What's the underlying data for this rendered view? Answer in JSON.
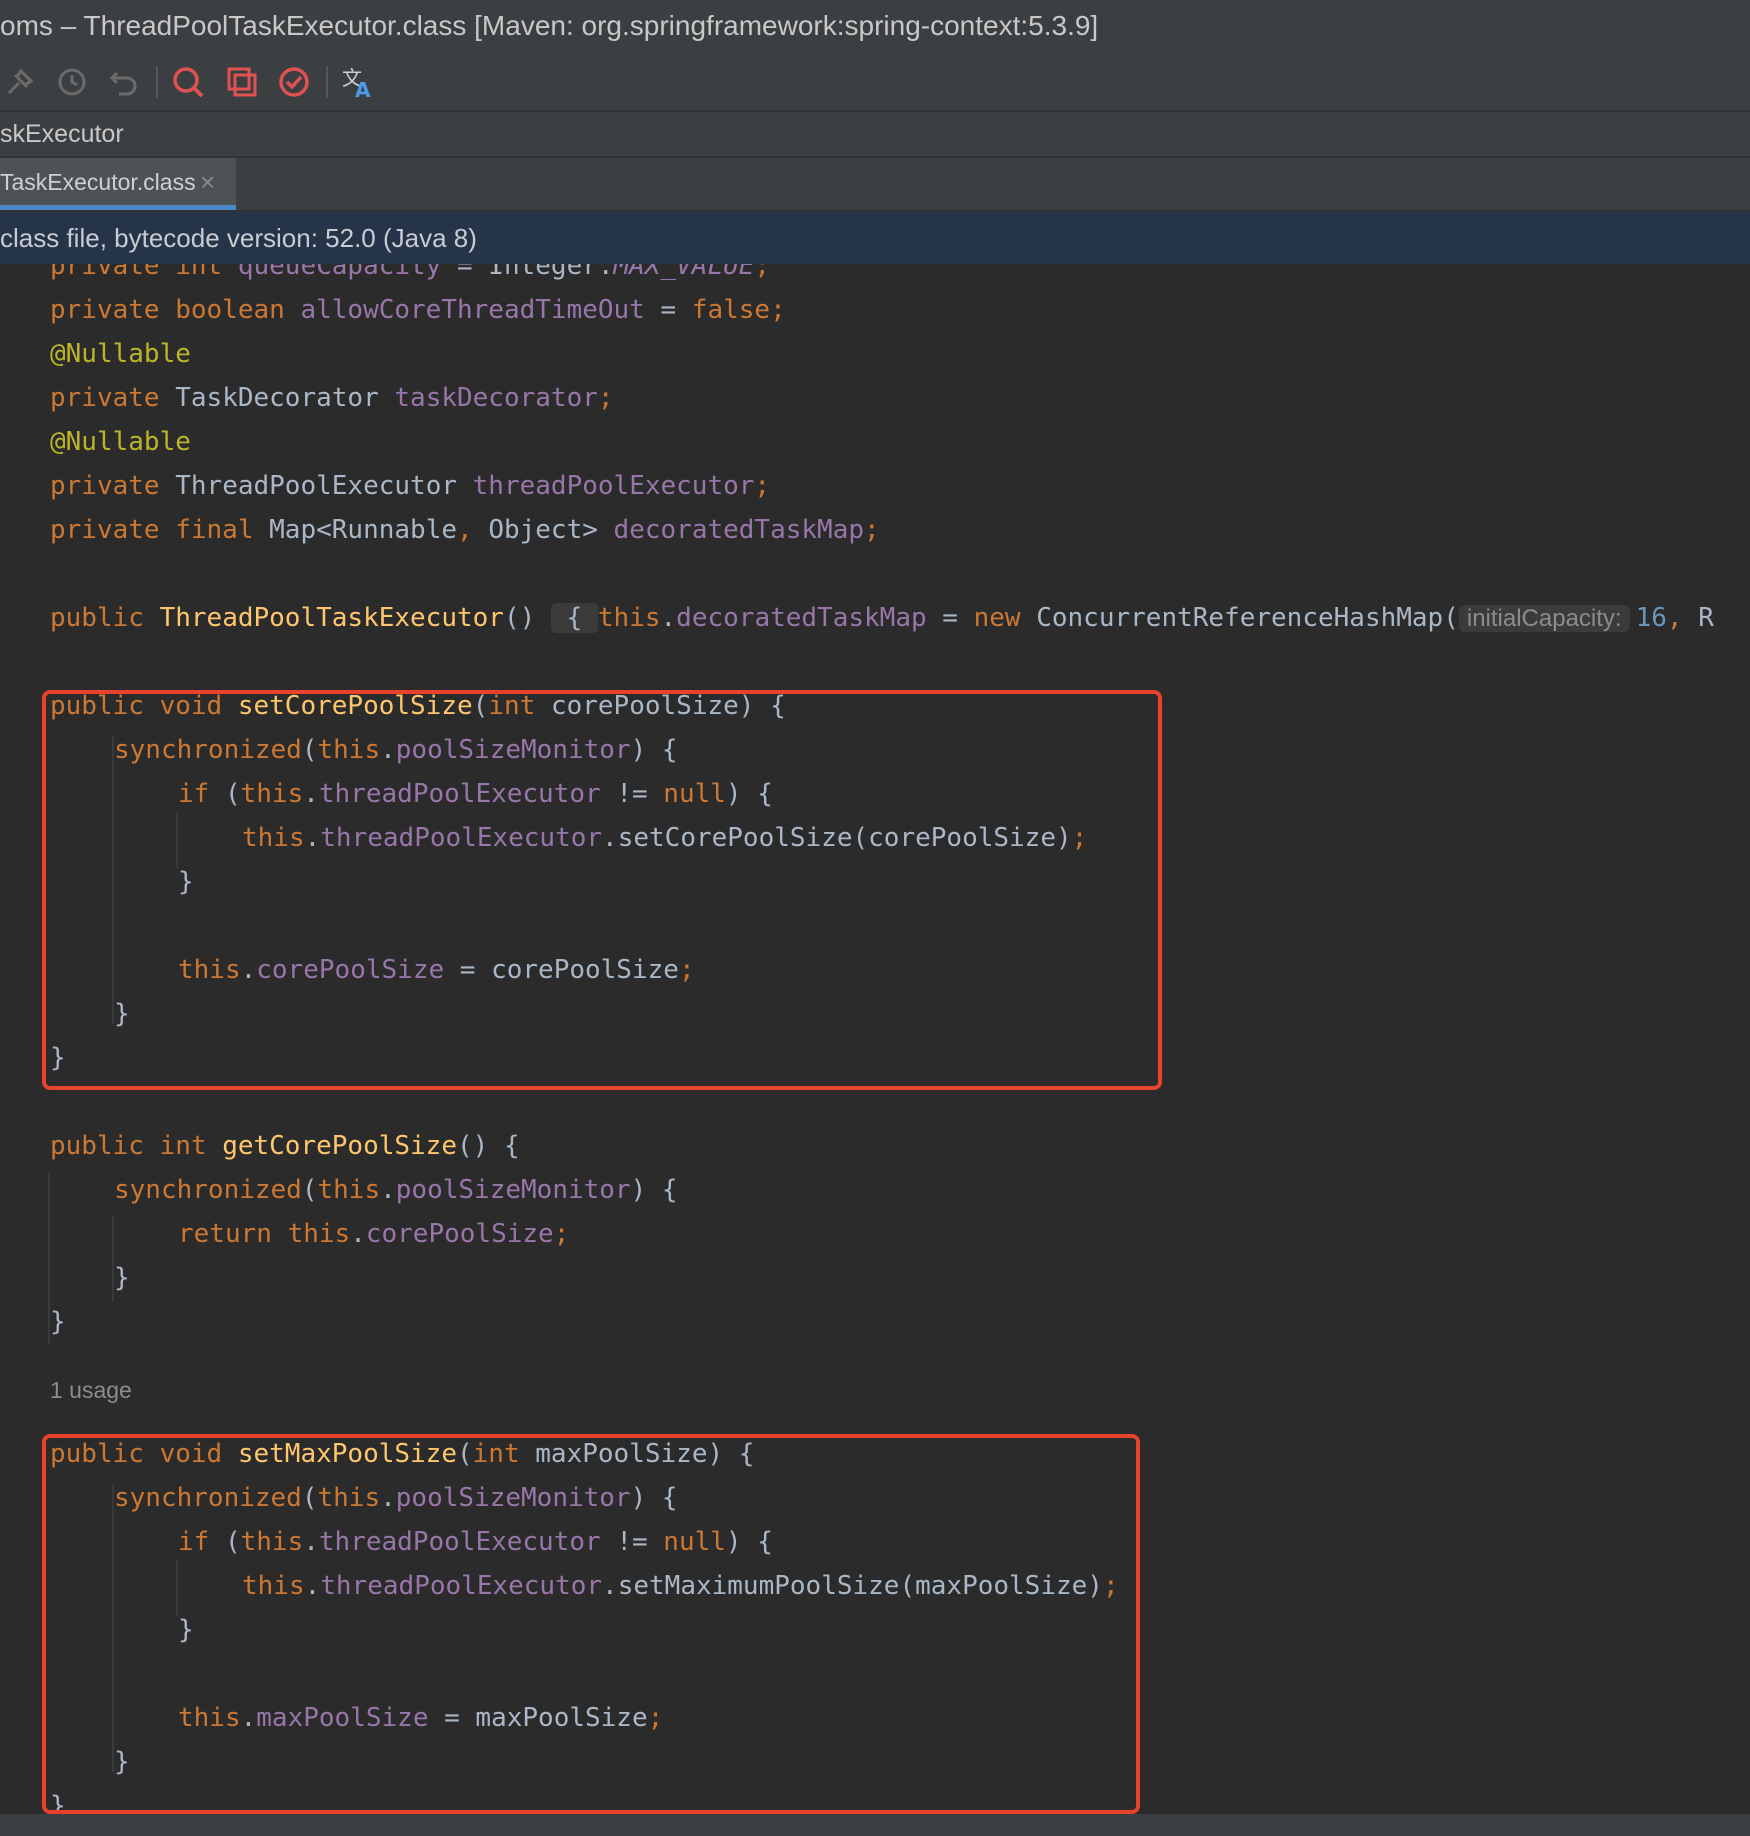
{
  "window": {
    "title": "oms – ThreadPoolTaskExecutor.class [Maven: org.springframework:spring-context:5.3.9]"
  },
  "toolbar": {
    "buttons": [
      "pin-icon",
      "history-icon",
      "undo-icon",
      "search-icon",
      "copy-icon",
      "check-icon",
      "translate-icon"
    ]
  },
  "breadcrumb": {
    "label": "skExecutor"
  },
  "tab": {
    "label": "TaskExecutor.class",
    "close": "×"
  },
  "banner": {
    "text": "class file, bytecode version: 52.0 (Java 8)"
  },
  "code": {
    "usage_label": "1 usage",
    "hint_initial_capacity": "initialCapacity:",
    "line_queue": {
      "kw": "private int ",
      "field": "queueCapacity",
      "op": " = Integer.",
      "const": "MAX_VALUE",
      "end": ";"
    },
    "lines": {
      "l1": "private boolean allowCoreThreadTimeOut = false;",
      "l2": "@Nullable",
      "l3": "private TaskDecorator taskDecorator;",
      "l4": "@Nullable",
      "l5": "private ThreadPoolExecutor threadPoolExecutor;",
      "l6": "private final Map<Runnable, Object> decoratedTaskMap;",
      "l7": "public ThreadPoolTaskExecutor() { this.decoratedTaskMap = new ConcurrentReferenceHashMap( initialCapacity: 16, R",
      "l8": "public void setCorePoolSize(int corePoolSize) {",
      "l9": "synchronized(this.poolSizeMonitor) {",
      "l10": "if (this.threadPoolExecutor != null) {",
      "l11": "this.threadPoolExecutor.setCorePoolSize(corePoolSize);",
      "l12": "}",
      "l13": "this.corePoolSize = corePoolSize;",
      "l14": "}",
      "l15": "}",
      "l16": "public int getCorePoolSize() {",
      "l17": "synchronized(this.poolSizeMonitor) {",
      "l18": "return this.corePoolSize;",
      "l19": "}",
      "l20": "}",
      "l21": "public void setMaxPoolSize(int maxPoolSize) {",
      "l22": "synchronized(this.poolSizeMonitor) {",
      "l23": "if (this.threadPoolExecutor != null) {",
      "l24": "this.threadPoolExecutor.setMaximumPoolSize(maxPoolSize);",
      "l25": "}",
      "l26": "this.maxPoolSize = maxPoolSize;",
      "l27": "}",
      "l28": "}"
    }
  },
  "colors": {
    "keyword": "#cc7832",
    "field": "#9876aa",
    "method": "#ffc66d",
    "annotation": "#bbb529",
    "number": "#6897bb",
    "highlight_box": "#e8412c",
    "editor_bg": "#2b2b2b"
  }
}
